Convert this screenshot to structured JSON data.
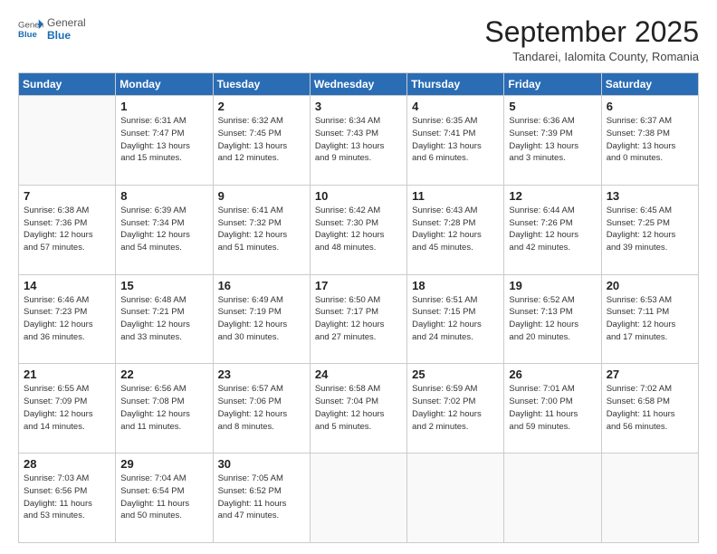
{
  "header": {
    "logo_general": "General",
    "logo_blue": "Blue",
    "month_title": "September 2025",
    "subtitle": "Tandarei, Ialomita County, Romania"
  },
  "days_of_week": [
    "Sunday",
    "Monday",
    "Tuesday",
    "Wednesday",
    "Thursday",
    "Friday",
    "Saturday"
  ],
  "weeks": [
    [
      {
        "day": "",
        "info": ""
      },
      {
        "day": "1",
        "info": "Sunrise: 6:31 AM\nSunset: 7:47 PM\nDaylight: 13 hours\nand 15 minutes."
      },
      {
        "day": "2",
        "info": "Sunrise: 6:32 AM\nSunset: 7:45 PM\nDaylight: 13 hours\nand 12 minutes."
      },
      {
        "day": "3",
        "info": "Sunrise: 6:34 AM\nSunset: 7:43 PM\nDaylight: 13 hours\nand 9 minutes."
      },
      {
        "day": "4",
        "info": "Sunrise: 6:35 AM\nSunset: 7:41 PM\nDaylight: 13 hours\nand 6 minutes."
      },
      {
        "day": "5",
        "info": "Sunrise: 6:36 AM\nSunset: 7:39 PM\nDaylight: 13 hours\nand 3 minutes."
      },
      {
        "day": "6",
        "info": "Sunrise: 6:37 AM\nSunset: 7:38 PM\nDaylight: 13 hours\nand 0 minutes."
      }
    ],
    [
      {
        "day": "7",
        "info": "Sunrise: 6:38 AM\nSunset: 7:36 PM\nDaylight: 12 hours\nand 57 minutes."
      },
      {
        "day": "8",
        "info": "Sunrise: 6:39 AM\nSunset: 7:34 PM\nDaylight: 12 hours\nand 54 minutes."
      },
      {
        "day": "9",
        "info": "Sunrise: 6:41 AM\nSunset: 7:32 PM\nDaylight: 12 hours\nand 51 minutes."
      },
      {
        "day": "10",
        "info": "Sunrise: 6:42 AM\nSunset: 7:30 PM\nDaylight: 12 hours\nand 48 minutes."
      },
      {
        "day": "11",
        "info": "Sunrise: 6:43 AM\nSunset: 7:28 PM\nDaylight: 12 hours\nand 45 minutes."
      },
      {
        "day": "12",
        "info": "Sunrise: 6:44 AM\nSunset: 7:26 PM\nDaylight: 12 hours\nand 42 minutes."
      },
      {
        "day": "13",
        "info": "Sunrise: 6:45 AM\nSunset: 7:25 PM\nDaylight: 12 hours\nand 39 minutes."
      }
    ],
    [
      {
        "day": "14",
        "info": "Sunrise: 6:46 AM\nSunset: 7:23 PM\nDaylight: 12 hours\nand 36 minutes."
      },
      {
        "day": "15",
        "info": "Sunrise: 6:48 AM\nSunset: 7:21 PM\nDaylight: 12 hours\nand 33 minutes."
      },
      {
        "day": "16",
        "info": "Sunrise: 6:49 AM\nSunset: 7:19 PM\nDaylight: 12 hours\nand 30 minutes."
      },
      {
        "day": "17",
        "info": "Sunrise: 6:50 AM\nSunset: 7:17 PM\nDaylight: 12 hours\nand 27 minutes."
      },
      {
        "day": "18",
        "info": "Sunrise: 6:51 AM\nSunset: 7:15 PM\nDaylight: 12 hours\nand 24 minutes."
      },
      {
        "day": "19",
        "info": "Sunrise: 6:52 AM\nSunset: 7:13 PM\nDaylight: 12 hours\nand 20 minutes."
      },
      {
        "day": "20",
        "info": "Sunrise: 6:53 AM\nSunset: 7:11 PM\nDaylight: 12 hours\nand 17 minutes."
      }
    ],
    [
      {
        "day": "21",
        "info": "Sunrise: 6:55 AM\nSunset: 7:09 PM\nDaylight: 12 hours\nand 14 minutes."
      },
      {
        "day": "22",
        "info": "Sunrise: 6:56 AM\nSunset: 7:08 PM\nDaylight: 12 hours\nand 11 minutes."
      },
      {
        "day": "23",
        "info": "Sunrise: 6:57 AM\nSunset: 7:06 PM\nDaylight: 12 hours\nand 8 minutes."
      },
      {
        "day": "24",
        "info": "Sunrise: 6:58 AM\nSunset: 7:04 PM\nDaylight: 12 hours\nand 5 minutes."
      },
      {
        "day": "25",
        "info": "Sunrise: 6:59 AM\nSunset: 7:02 PM\nDaylight: 12 hours\nand 2 minutes."
      },
      {
        "day": "26",
        "info": "Sunrise: 7:01 AM\nSunset: 7:00 PM\nDaylight: 11 hours\nand 59 minutes."
      },
      {
        "day": "27",
        "info": "Sunrise: 7:02 AM\nSunset: 6:58 PM\nDaylight: 11 hours\nand 56 minutes."
      }
    ],
    [
      {
        "day": "28",
        "info": "Sunrise: 7:03 AM\nSunset: 6:56 PM\nDaylight: 11 hours\nand 53 minutes."
      },
      {
        "day": "29",
        "info": "Sunrise: 7:04 AM\nSunset: 6:54 PM\nDaylight: 11 hours\nand 50 minutes."
      },
      {
        "day": "30",
        "info": "Sunrise: 7:05 AM\nSunset: 6:52 PM\nDaylight: 11 hours\nand 47 minutes."
      },
      {
        "day": "",
        "info": ""
      },
      {
        "day": "",
        "info": ""
      },
      {
        "day": "",
        "info": ""
      },
      {
        "day": "",
        "info": ""
      }
    ]
  ]
}
